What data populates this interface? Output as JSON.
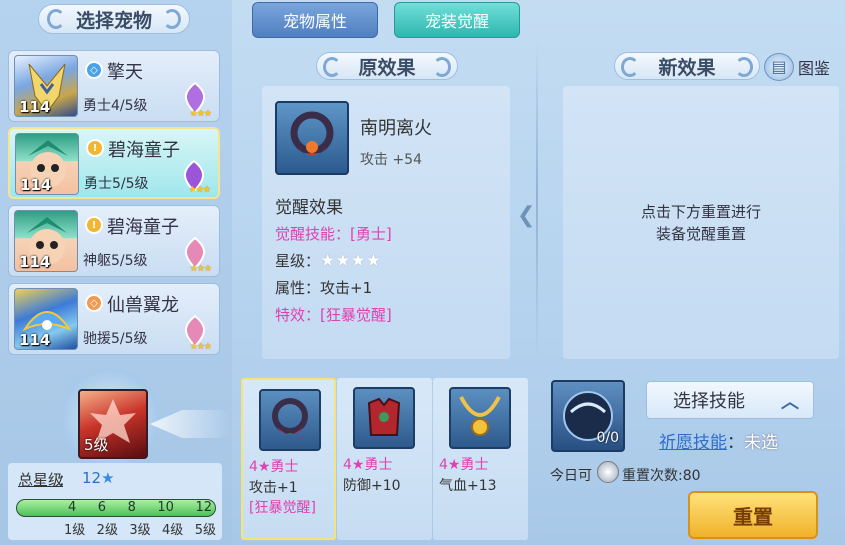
{
  "left": {
    "title": "选择宠物",
    "pets": [
      {
        "level": "114",
        "name": "擎天",
        "rank": "勇士4/5级",
        "badge_color": "#4aa3e8"
      },
      {
        "level": "114",
        "name": "碧海童子",
        "rank": "勇士5/5级",
        "badge_color": "#f2b632"
      },
      {
        "level": "114",
        "name": "碧海童子",
        "rank": "神躯5/5级",
        "badge_color": "#f2b632"
      },
      {
        "level": "114",
        "name": "仙兽翼龙",
        "rank": "驰援5/5级",
        "badge_color": "#f29a52"
      }
    ],
    "skill_level": "5级",
    "total_star_label": "总星级",
    "total_star_value": "12",
    "star_marks": [
      "4",
      "6",
      "8",
      "10",
      "12"
    ],
    "level_marks": [
      "1级",
      "2级",
      "3级",
      "4级",
      "5级"
    ],
    "star_progress_fraction": 1.0
  },
  "tabs": [
    {
      "label": "宠物属性",
      "active": false
    },
    {
      "label": "宠装觉醒",
      "active": true
    }
  ],
  "original": {
    "title": "原效果",
    "item_name": "南明离火",
    "item_attack": "攻击 +54",
    "awaken_title": "觉醒效果",
    "skill_line": "觉醒技能：[勇士]",
    "star_line_label": "星级：",
    "star_line_stars": "★★★★",
    "attr_line": "属性：攻击+1",
    "special_line": "特效：[狂暴觉醒]"
  },
  "new_effect": {
    "title": "新效果",
    "codex_label": "图鉴",
    "hint_line1": "点击下方重置进行",
    "hint_line2": "装备觉醒重置"
  },
  "items": [
    {
      "rank": "4★勇士",
      "stat": "攻击+1",
      "extra": "[狂暴觉醒]",
      "selected": true
    },
    {
      "rank": "4★勇士",
      "stat": "防御+10",
      "extra": "",
      "selected": false
    },
    {
      "rank": "4★勇士",
      "stat": "气血+13",
      "extra": "",
      "selected": false
    }
  ],
  "bottom_right": {
    "counter": "0/0",
    "select_skill": "选择技能",
    "wish_skill_label": "祈愿技能",
    "wish_skill_sep": "：",
    "wish_skill_value": "未选",
    "today_label": "今日可",
    "reset_count_label": "重置次数:80",
    "reset_button": "重置"
  },
  "colors": {
    "accent_pink": "#e23fb0",
    "tab_active": "#3bc9c2",
    "tab_inactive": "#5b8ac4"
  }
}
